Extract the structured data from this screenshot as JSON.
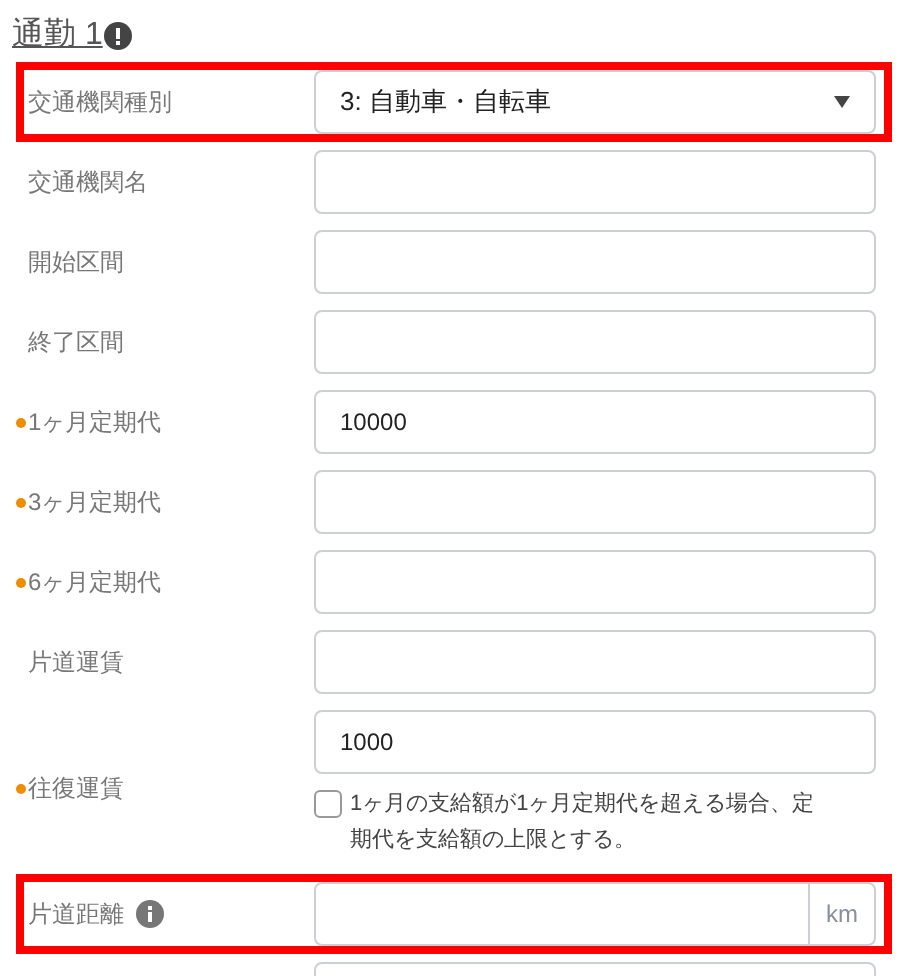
{
  "section": {
    "title": "通勤 1"
  },
  "rows": [
    {
      "kind": "select",
      "label": "交通機関種別",
      "value": "3: 自動車・自転車",
      "required": false,
      "highlighted": true
    },
    {
      "kind": "text",
      "label": "交通機関名",
      "required": false,
      "highlighted": false
    },
    {
      "kind": "text",
      "label": "開始区間",
      "required": false,
      "highlighted": false
    },
    {
      "kind": "text",
      "label": "終了区間",
      "required": false,
      "highlighted": false
    },
    {
      "kind": "text",
      "label": "1ヶ月定期代",
      "value": "10000",
      "required": true,
      "highlighted": false
    },
    {
      "kind": "text",
      "label": "3ヶ月定期代",
      "required": true,
      "highlighted": false
    },
    {
      "kind": "text",
      "label": "6ヶ月定期代",
      "required": true,
      "highlighted": false
    },
    {
      "kind": "text",
      "label": "片道運賃",
      "required": false,
      "highlighted": false
    },
    {
      "kind": "text_check",
      "label": "往復運賃",
      "value": "1000",
      "required": true,
      "highlighted": false,
      "checkbox": {
        "label": "1ヶ月の支給額が1ヶ月定期代を超える場合、定期代を支給額の上限とする。",
        "checked": false
      }
    },
    {
      "kind": "unit",
      "label": "片道距離",
      "info": true,
      "unit": "km",
      "required": false,
      "highlighted": true
    },
    {
      "kind": "text"
    }
  ]
}
